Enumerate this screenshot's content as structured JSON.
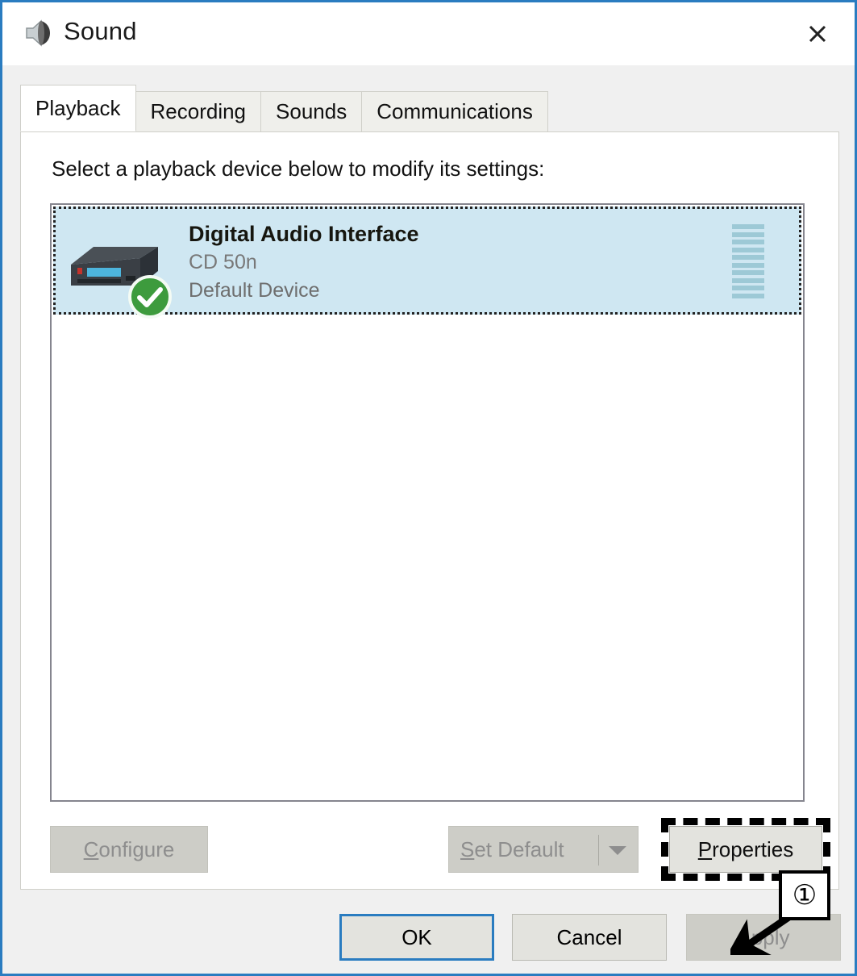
{
  "window": {
    "title": "Sound",
    "icon": "speaker-icon",
    "close_label": "✕",
    "border_color": "#2a7cc0"
  },
  "tabs": [
    {
      "label": "Playback",
      "active": true
    },
    {
      "label": "Recording",
      "active": false
    },
    {
      "label": "Sounds",
      "active": false
    },
    {
      "label": "Communications",
      "active": false
    }
  ],
  "panel": {
    "instruction": "Select a playback device below to modify its settings:"
  },
  "devices": [
    {
      "name": "Digital Audio Interface",
      "model": "CD 50n",
      "status": "Default Device",
      "icon": "audio-receiver-icon",
      "badge": "default-check-badge",
      "selected": true,
      "meter_bars": 10,
      "meter_color": "#9dc9d6",
      "selected_bg": "#cfe7f2"
    }
  ],
  "mid_buttons": {
    "configure": {
      "label": "Configure",
      "accel": "C",
      "enabled": false
    },
    "set_default": {
      "label": "Set Default",
      "accel": "S",
      "enabled": false,
      "has_dropdown": true
    },
    "properties": {
      "label": "Properties",
      "accel": "P",
      "enabled": true,
      "highlighted": true
    }
  },
  "callout": {
    "number": "①",
    "points_to": "properties-button"
  },
  "footer": {
    "ok": {
      "label": "OK",
      "enabled": true,
      "focused": true
    },
    "cancel": {
      "label": "Cancel",
      "enabled": true
    },
    "apply": {
      "label": "Apply",
      "accel": "A",
      "enabled": false
    }
  }
}
